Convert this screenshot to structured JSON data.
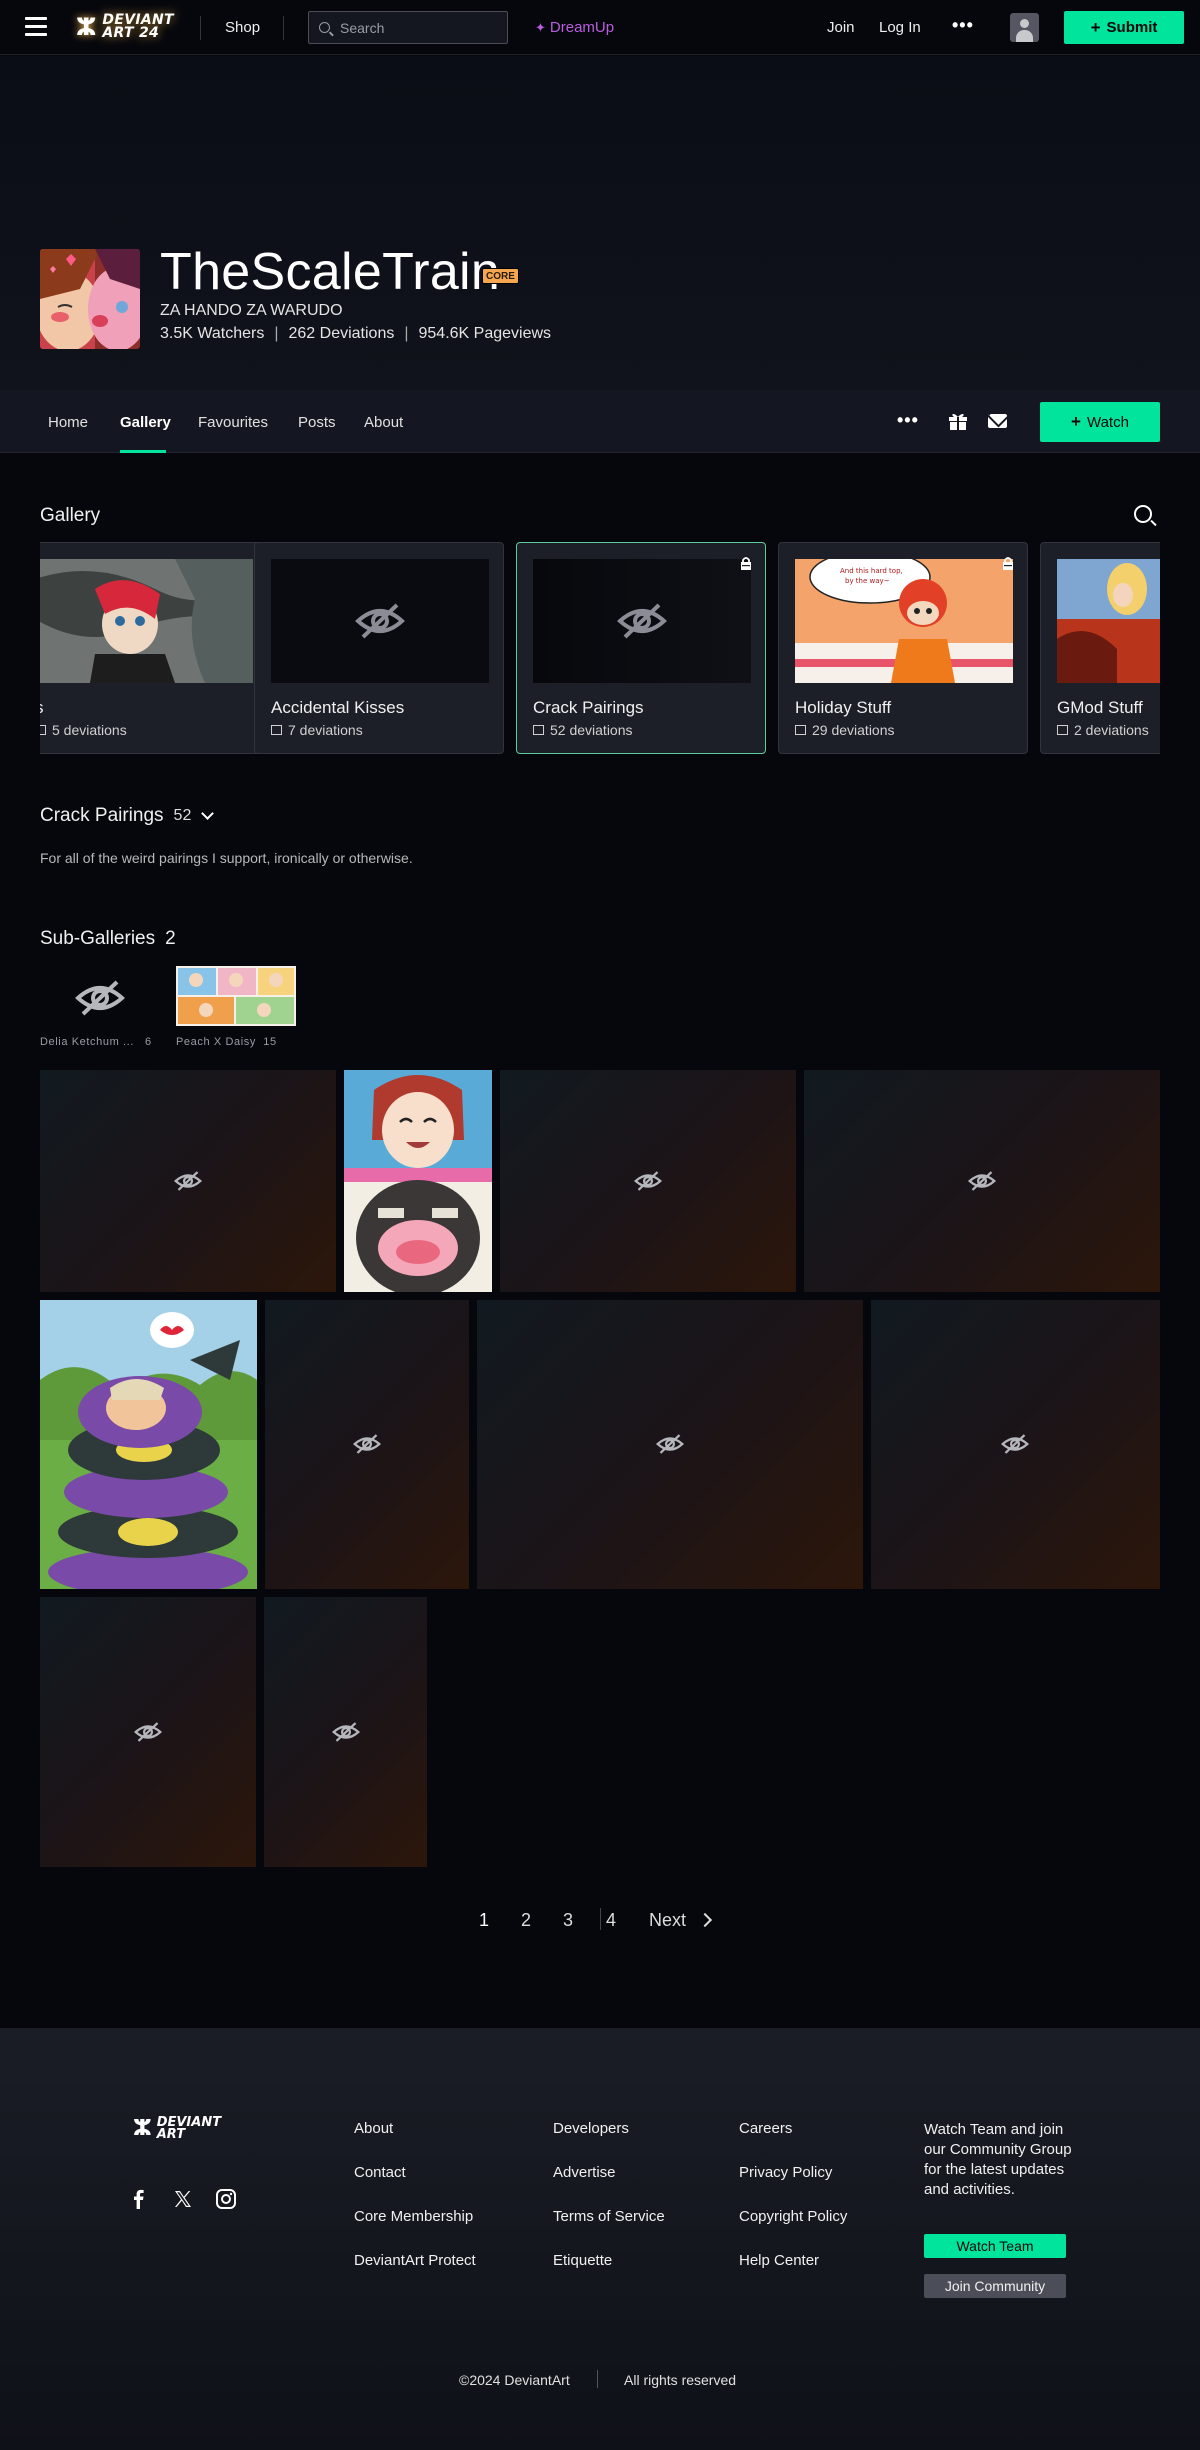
{
  "topbar": {
    "logo_line1": "DEVIANT",
    "logo_line2": "ART 24",
    "shop": "Shop",
    "search_placeholder": "Search",
    "dreamup": "DreamUp",
    "join": "Join",
    "login": "Log In",
    "more": "•••",
    "submit": "Submit"
  },
  "profile": {
    "username": "TheScaleTrain",
    "badge": "CORE",
    "tagline": "ZA HANDO ZA WARUDO",
    "watchers": "3.5K Watchers",
    "deviations": "262 Deviations",
    "pageviews": "954.6K Pageviews",
    "divider": "|"
  },
  "tabs": {
    "items": [
      "Home",
      "Gallery",
      "Favourites",
      "Posts",
      "About"
    ],
    "active": "Gallery",
    "more": "•••",
    "watch": "Watch"
  },
  "gallery": {
    "title": "Gallery",
    "folders": [
      {
        "title": "s",
        "count": "5 deviations",
        "thumb": "image",
        "locked": false
      },
      {
        "title": "Accidental Kisses",
        "count": "7 deviations",
        "thumb": "hidden",
        "locked": false
      },
      {
        "title": "Crack Pairings",
        "count": "52 deviations",
        "thumb": "hidden",
        "locked": true,
        "selected": true
      },
      {
        "title": "Holiday Stuff",
        "count": "29 deviations",
        "thumb": "image",
        "locked": true
      },
      {
        "title": "GMod Stuff",
        "count": "2 deviations",
        "thumb": "image",
        "locked": false
      }
    ]
  },
  "folder": {
    "title": "Crack Pairings",
    "count": "52",
    "description": "For all of the weird pairings I support, ironically or otherwise."
  },
  "subgalleries": {
    "title": "Sub-Galleries",
    "count": "2",
    "items": [
      {
        "label": "Delia Ketchum ...",
        "count": "6"
      },
      {
        "label": "Peach X Daisy",
        "count": "15"
      }
    ]
  },
  "pagination": {
    "pages": [
      "1",
      "2",
      "3",
      "4"
    ],
    "current": "1",
    "next": "Next"
  },
  "footer": {
    "logo_line1": "DEVIANT",
    "logo_line2": "ART",
    "col1": [
      "About",
      "Contact",
      "Core Membership",
      "DeviantArt Protect"
    ],
    "col2": [
      "Developers",
      "Advertise",
      "Terms of Service",
      "Etiquette"
    ],
    "col3": [
      "Careers",
      "Privacy Policy",
      "Copyright Policy",
      "Help Center"
    ],
    "watch_team_text": "Watch Team and join our Community Group for the latest updates and activities.",
    "watch_team_button": "Watch Team",
    "join_community_button": "Join Community",
    "copyright": "©2024 DeviantArt",
    "rights": "All rights reserved"
  },
  "colors": {
    "accent": "#00e59b",
    "dreamup": "#b95ddd",
    "core_badge": "#f5a651",
    "background": "#06070d"
  }
}
